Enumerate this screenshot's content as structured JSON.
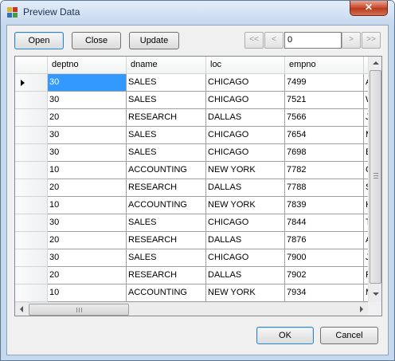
{
  "window": {
    "title": "Preview Data",
    "close_glyph": "✕",
    "icon": "grid-app-icon"
  },
  "toolbar": {
    "open_label": "Open",
    "close_label": "Close",
    "update_label": "Update"
  },
  "navigator": {
    "first_label": "<<",
    "prev_label": "<",
    "position_value": "0",
    "next_label": ">",
    "last_label": ">>"
  },
  "grid": {
    "columns": [
      "deptno",
      "dname",
      "loc",
      "empno"
    ],
    "current_row": 0,
    "rows": [
      {
        "deptno": "30",
        "dname": "SALES",
        "loc": "CHICAGO",
        "empno": "7499",
        "next": "A"
      },
      {
        "deptno": "30",
        "dname": "SALES",
        "loc": "CHICAGO",
        "empno": "7521",
        "next": "W"
      },
      {
        "deptno": "20",
        "dname": "RESEARCH",
        "loc": "DALLAS",
        "empno": "7566",
        "next": "J"
      },
      {
        "deptno": "30",
        "dname": "SALES",
        "loc": "CHICAGO",
        "empno": "7654",
        "next": "M"
      },
      {
        "deptno": "30",
        "dname": "SALES",
        "loc": "CHICAGO",
        "empno": "7698",
        "next": "B"
      },
      {
        "deptno": "10",
        "dname": "ACCOUNTING",
        "loc": "NEW YORK",
        "empno": "7782",
        "next": "C"
      },
      {
        "deptno": "20",
        "dname": "RESEARCH",
        "loc": "DALLAS",
        "empno": "7788",
        "next": "S"
      },
      {
        "deptno": "10",
        "dname": "ACCOUNTING",
        "loc": "NEW YORK",
        "empno": "7839",
        "next": "K"
      },
      {
        "deptno": "30",
        "dname": "SALES",
        "loc": "CHICAGO",
        "empno": "7844",
        "next": "T"
      },
      {
        "deptno": "20",
        "dname": "RESEARCH",
        "loc": "DALLAS",
        "empno": "7876",
        "next": "A"
      },
      {
        "deptno": "30",
        "dname": "SALES",
        "loc": "CHICAGO",
        "empno": "7900",
        "next": "J"
      },
      {
        "deptno": "20",
        "dname": "RESEARCH",
        "loc": "DALLAS",
        "empno": "7902",
        "next": "F"
      },
      {
        "deptno": "10",
        "dname": "ACCOUNTING",
        "loc": "NEW YORK",
        "empno": "7934",
        "next": "M"
      },
      {
        "deptno": "",
        "dname": "",
        "loc": "",
        "empno": "",
        "next": ""
      }
    ]
  },
  "footer": {
    "ok_label": "OK",
    "cancel_label": "Cancel"
  },
  "colors": {
    "selection": "#3399ff",
    "close_button": "#c8462a",
    "title_text": "#1e3050"
  }
}
